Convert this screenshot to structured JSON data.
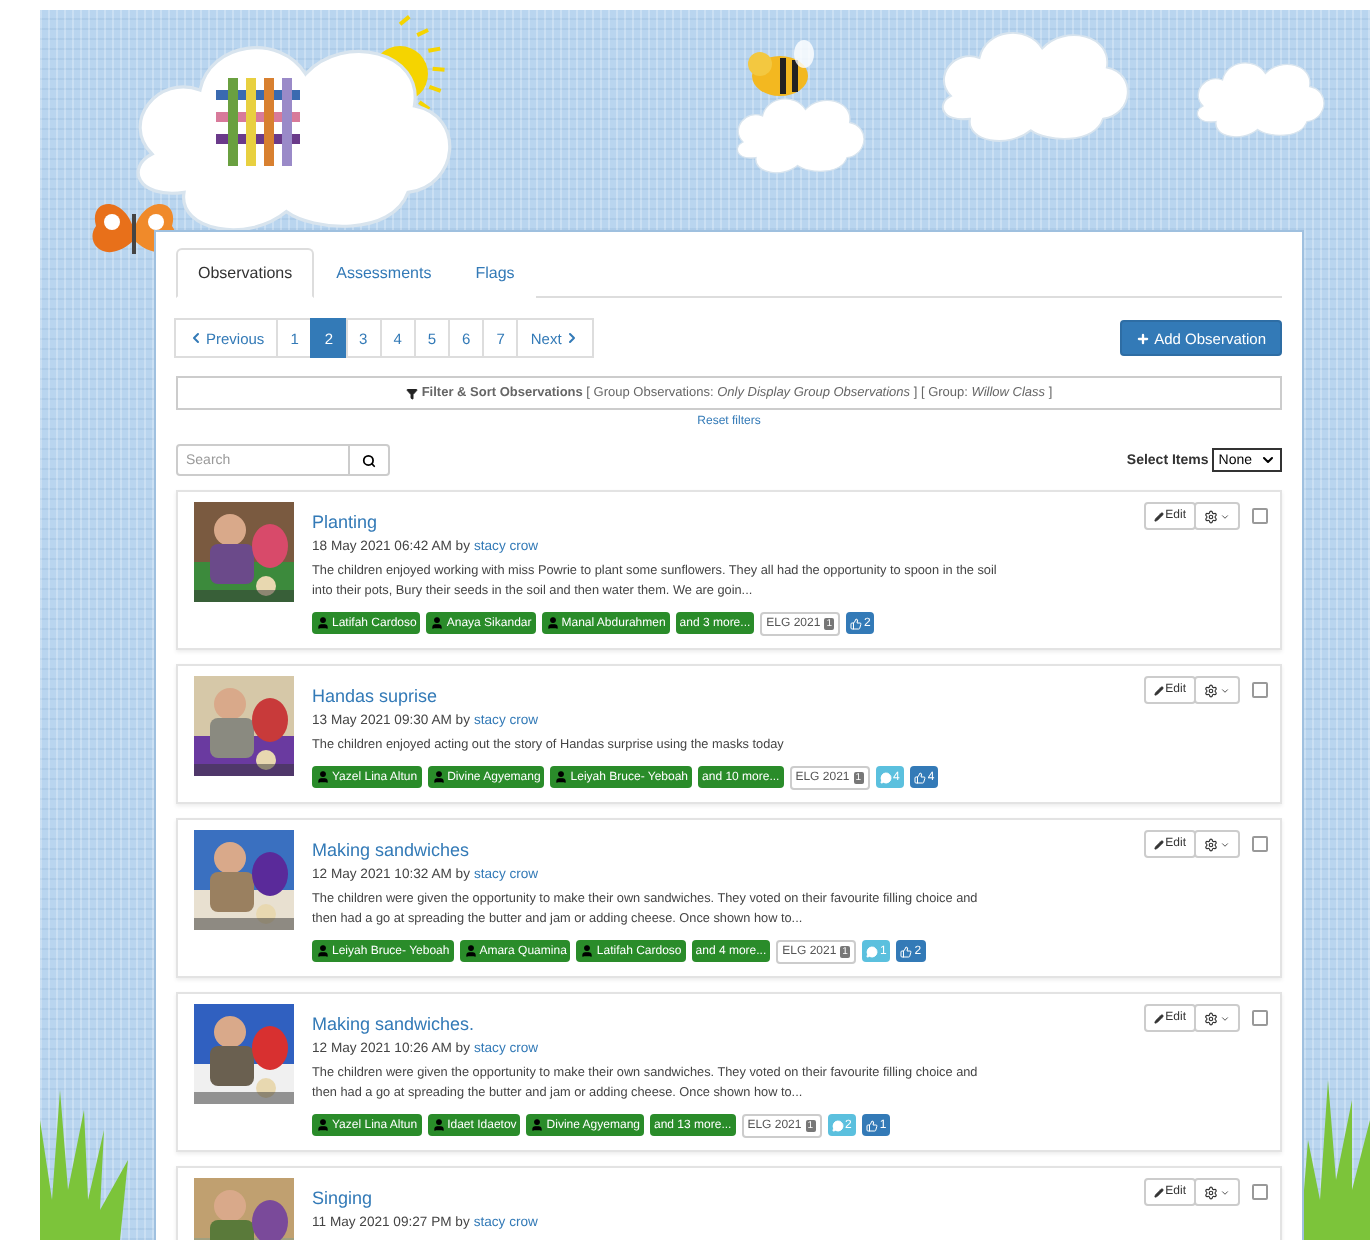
{
  "tabs": [
    {
      "label": "Observations",
      "selected": true
    },
    {
      "label": "Assessments",
      "selected": false
    },
    {
      "label": "Flags",
      "selected": false
    }
  ],
  "pagination": {
    "previous": "Previous",
    "next": "Next",
    "pages": [
      {
        "label": "1",
        "selected": false
      },
      {
        "label": "2",
        "selected": true
      },
      {
        "label": "3",
        "selected": false
      },
      {
        "label": "4",
        "selected": false
      },
      {
        "label": "5",
        "selected": false
      },
      {
        "label": "6",
        "selected": false
      },
      {
        "label": "7",
        "selected": false
      }
    ]
  },
  "add_button": "Add Observation",
  "filter_bar": "**Filter & Sort Observations** [ Group Observations: *Only Display Group Observations* ] [ Group: *Willow Class* ]",
  "reset_link": "Reset filters",
  "search": {
    "placeholder": "Search"
  },
  "select_items": {
    "label": "Select Items",
    "value": "None"
  },
  "observations": [
    {
      "title": "Planting",
      "meta": "18 May 2021 06:42 AM by",
      "author": "stacy crow",
      "text": "The children enjoyed working with miss Powrie to plant some sunflowers. They all had the opportunity to spoon in the soil into their pots, Bury their seeds in the soil and then water them. We are goin...",
      "children": [
        "Latifah Cardoso",
        "Anaya Sikandar",
        "Manal Abdurahmen"
      ],
      "more": "and 3 more...",
      "framework": "ELG 2021",
      "framework_count": "1",
      "likes": "2",
      "edit": "Edit",
      "checked": false
    },
    {
      "title": "Handas suprise",
      "meta": "13 May 2021 09:30 AM by",
      "author": "stacy crow",
      "text": "The children enjoyed acting out the story of Handas surprise using the masks today",
      "children": [
        "Yazel Lina Altun",
        "Divine Agyemang",
        "Leiyah Bruce- Yeboah"
      ],
      "more": "and 10 more...",
      "framework": "ELG 2021",
      "framework_count": "1",
      "comments": "4",
      "likes": "4",
      "edit": "Edit",
      "checked": false
    },
    {
      "title": "Making sandwiches",
      "meta": "12 May 2021 10:32 AM by",
      "author": "stacy crow",
      "text": "The children were given the opportunity to make their own sandwiches. They voted on their favourite filling choice and then had a go at spreading the butter and jam or adding cheese. Once shown how to...",
      "children": [
        "Leiyah Bruce- Yeboah",
        "Amara Quamina",
        "Latifah Cardoso"
      ],
      "more": "and 4 more...",
      "framework": "ELG 2021",
      "framework_count": "1",
      "comments": "1",
      "likes": "2",
      "edit": "Edit",
      "checked": false
    },
    {
      "title": "Making sandwiches.",
      "meta": "12 May 2021 10:26 AM by",
      "author": "stacy crow",
      "text": "The children were given the opportunity to make their own sandwiches. They voted on their favourite filling choice and then had a go at spreading the butter and jam or adding cheese. Once shown how to...",
      "children": [
        "Yazel Lina Altun",
        "Idaet Idaetov",
        "Divine Agyemang"
      ],
      "more": "and 13 more...",
      "framework": "ELG 2021",
      "framework_count": "1",
      "comments": "2",
      "likes": "1",
      "edit": "Edit",
      "checked": false
    },
    {
      "title": "Singing",
      "meta": "11 May 2021 09:27 PM by",
      "author": "stacy crow",
      "edit": "Edit",
      "checked": false
    }
  ]
}
